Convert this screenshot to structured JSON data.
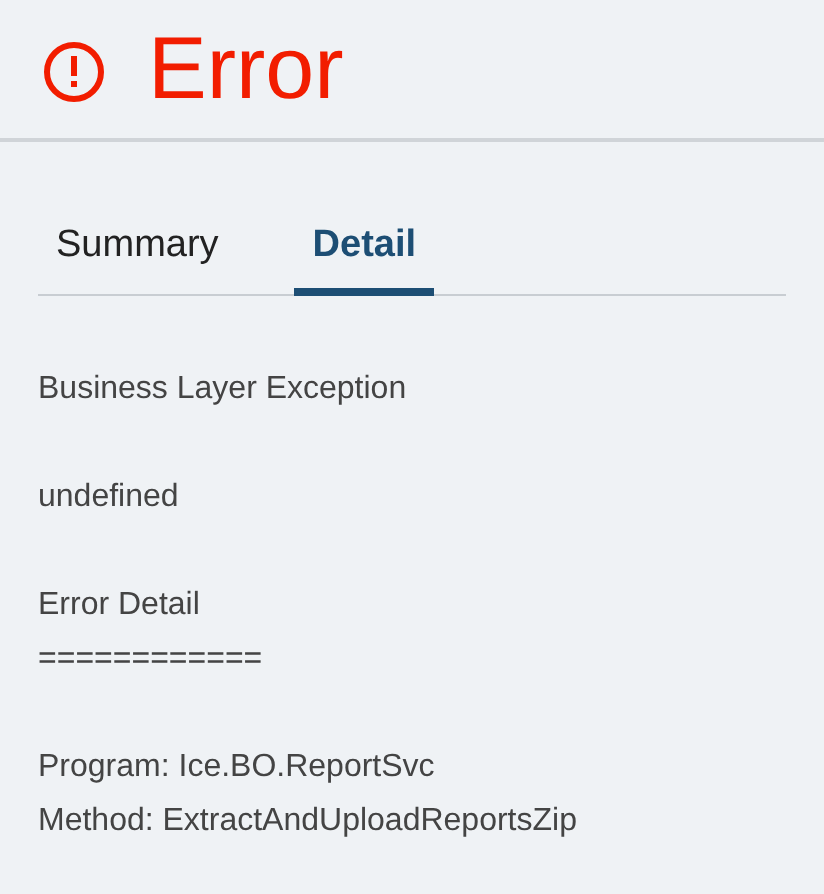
{
  "header": {
    "title": "Error"
  },
  "tabs": [
    {
      "label": "Summary",
      "selected": false
    },
    {
      "label": "Detail",
      "selected": true
    }
  ],
  "detail": {
    "paragraphs": [
      [
        "Business Layer Exception"
      ],
      [
        "undefined"
      ],
      [
        "Error Detail",
        "============"
      ],
      [
        "Program: Ice.BO.ReportSvc",
        "Method: ExtractAndUploadReportsZip"
      ]
    ]
  }
}
